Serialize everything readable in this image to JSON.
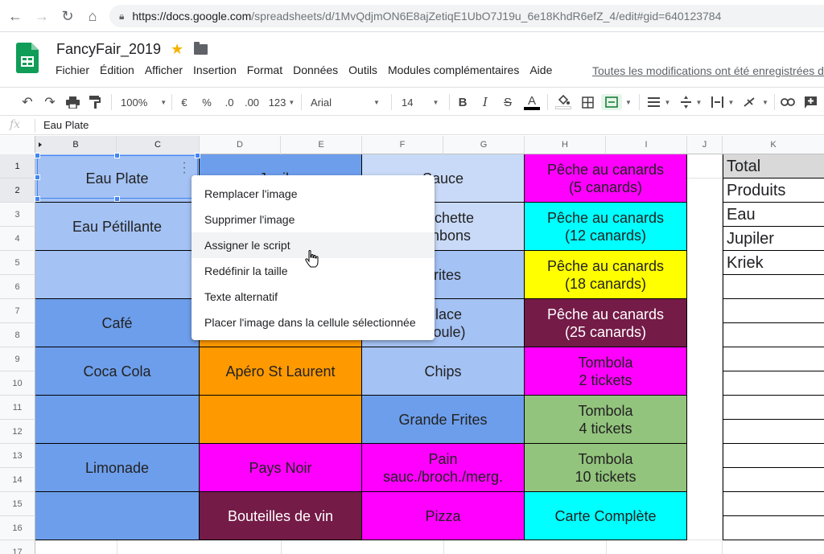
{
  "browser": {
    "url_host": "https://docs.google.com",
    "url_path": "/spreadsheets/d/1MvQdjmON6E8ajZetiqE1UbO7J19u_6e18KhdR6efZ_4/edit#gid=640123784"
  },
  "doc": {
    "title": "FancyFair_2019",
    "save_status": "Toutes les modifications ont été enregistrées dans Drive"
  },
  "menu": [
    "Fichier",
    "Édition",
    "Afficher",
    "Insertion",
    "Format",
    "Données",
    "Outils",
    "Modules complémentaires",
    "Aide"
  ],
  "toolbar": {
    "zoom": "100%",
    "currency": "€",
    "percent": "%",
    "decimal_less": ".0",
    "decimal_more": ".00",
    "number_format": "123",
    "font": "Arial",
    "font_size": "14",
    "bold": "B",
    "italic": "I",
    "strike": "S",
    "text_color": "A"
  },
  "formula": {
    "label": "fx",
    "value": "Eau Plate"
  },
  "columns": [
    "B",
    "C",
    "D",
    "E",
    "F",
    "G",
    "H",
    "I",
    "J",
    "K"
  ],
  "rows": [
    "1",
    "2",
    "3",
    "4",
    "5",
    "6",
    "7",
    "8",
    "9",
    "10",
    "11",
    "12",
    "13",
    "14",
    "15",
    "16",
    "17"
  ],
  "blocks": {
    "col_b": [
      "Eau Plate",
      "Eau Pétillante",
      "",
      "Café",
      "Coca Cola",
      "",
      "Limonade",
      ""
    ],
    "col_d": [
      "Jupiler",
      "",
      "",
      "",
      "Apéro St Laurent",
      "",
      "Pays Noir",
      "Bouteilles de vin"
    ],
    "col_f": [
      "Sauce",
      "Brochette\nbonbons",
      "Frites",
      "Glace\n(boule)",
      "Chips",
      "Grande Frites",
      "Pain\nsauc./broch./merg.",
      "Pizza"
    ],
    "col_h": [
      "Pêche au canards\n(5 canards)",
      "Pêche au canards\n(12 canards)",
      "Pêche au canards\n(18 canards)",
      "Pêche au canards\n(25 canards)",
      "Tombola\n2 tickets",
      "Tombola\n4 tickets",
      "Tombola\n10 tickets",
      "Carte Complète"
    ]
  },
  "side_list": [
    "Total",
    "Produits",
    "Eau",
    "Jupiler",
    "Kriek"
  ],
  "context_menu": [
    "Remplacer l'image",
    "Supprimer l'image",
    "Assigner le script",
    "Redéfinir la taille",
    "Texte alternatif",
    "Placer l'image dans la cellule sélectionnée"
  ],
  "colors": {
    "light_blue": "#a4c2f4",
    "mid_blue": "#6d9eeb",
    "pale_blue": "#c9daf8",
    "orange": "#ff9900",
    "magenta": "#ff00ff",
    "wine": "#741b47",
    "cyan": "#00ffff",
    "yellow": "#ffff00",
    "green": "#93c47d",
    "gray": "#d9d9d9"
  }
}
